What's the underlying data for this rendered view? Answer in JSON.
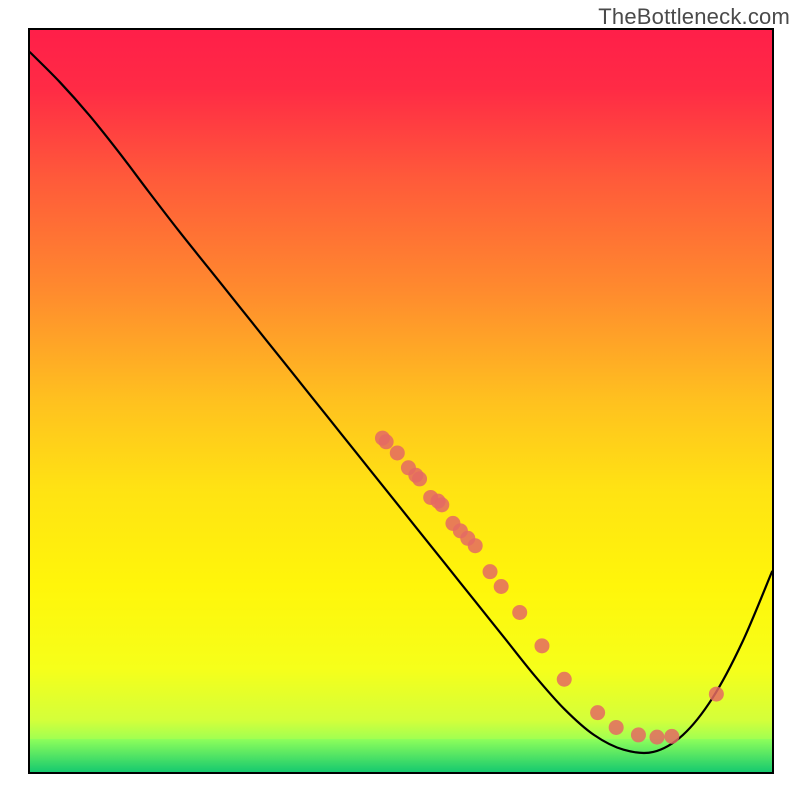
{
  "watermark": "TheBottleneck.com",
  "plot": {
    "inner_left": 30,
    "inner_top": 30,
    "inner_size": 742,
    "border_color": "#000000",
    "border_width": 2,
    "gradient_stops": [
      {
        "offset": 0.0,
        "color": "#ff1f49"
      },
      {
        "offset": 0.08,
        "color": "#ff2b45"
      },
      {
        "offset": 0.2,
        "color": "#ff5a3a"
      },
      {
        "offset": 0.35,
        "color": "#ff8a2e"
      },
      {
        "offset": 0.5,
        "color": "#ffc11f"
      },
      {
        "offset": 0.62,
        "color": "#ffe313"
      },
      {
        "offset": 0.75,
        "color": "#fff60a"
      },
      {
        "offset": 0.86,
        "color": "#f6ff1a"
      },
      {
        "offset": 0.93,
        "color": "#d4ff3a"
      },
      {
        "offset": 0.965,
        "color": "#8eff5a"
      },
      {
        "offset": 0.99,
        "color": "#34e27a"
      },
      {
        "offset": 1.0,
        "color": "#15c96f"
      }
    ],
    "green_band": {
      "top_frac": 0.955,
      "bottom_frac": 1.0,
      "top_color": "#8eff5a",
      "bottom_color": "#15c96f"
    }
  },
  "chart_data": {
    "type": "line",
    "title": "",
    "xlabel": "",
    "ylabel": "",
    "xlim": [
      0,
      100
    ],
    "ylim": [
      0,
      100
    ],
    "curve": {
      "x": [
        0,
        4,
        8,
        12,
        16,
        20,
        24,
        28,
        32,
        36,
        40,
        44,
        48,
        52,
        56,
        60,
        64,
        68,
        72,
        76,
        80,
        84,
        88,
        92,
        96,
        100
      ],
      "y_from_top": [
        3.0,
        7.0,
        11.5,
        16.5,
        21.8,
        27.0,
        32.0,
        37.0,
        42.0,
        47.0,
        52.0,
        57.0,
        62.0,
        67.0,
        72.0,
        77.0,
        82.0,
        87.0,
        91.5,
        95.0,
        97.0,
        97.3,
        95.0,
        90.0,
        82.5,
        73.0
      ]
    },
    "series": [
      {
        "name": "points",
        "marker": "circle",
        "color": "#e46a63",
        "x": [
          47.5,
          48.0,
          49.5,
          51.0,
          52.0,
          52.5,
          54.0,
          55.0,
          55.5,
          57.0,
          58.0,
          59.0,
          60.0,
          62.0,
          63.5,
          66.0,
          69.0,
          72.0,
          76.5,
          79.0,
          82.0,
          84.5,
          86.5,
          92.5
        ],
        "y_from_top": [
          55.0,
          55.5,
          57.0,
          59.0,
          60.0,
          60.5,
          63.0,
          63.5,
          64.0,
          66.5,
          67.5,
          68.5,
          69.5,
          73.0,
          75.0,
          78.5,
          83.0,
          87.5,
          92.0,
          94.0,
          95.0,
          95.3,
          95.2,
          89.5
        ]
      }
    ],
    "curve_style": {
      "color": "#000000",
      "width": 2.2
    },
    "point_style": {
      "radius": 7.5,
      "fill": "#e46a63",
      "opacity": 0.85
    }
  }
}
